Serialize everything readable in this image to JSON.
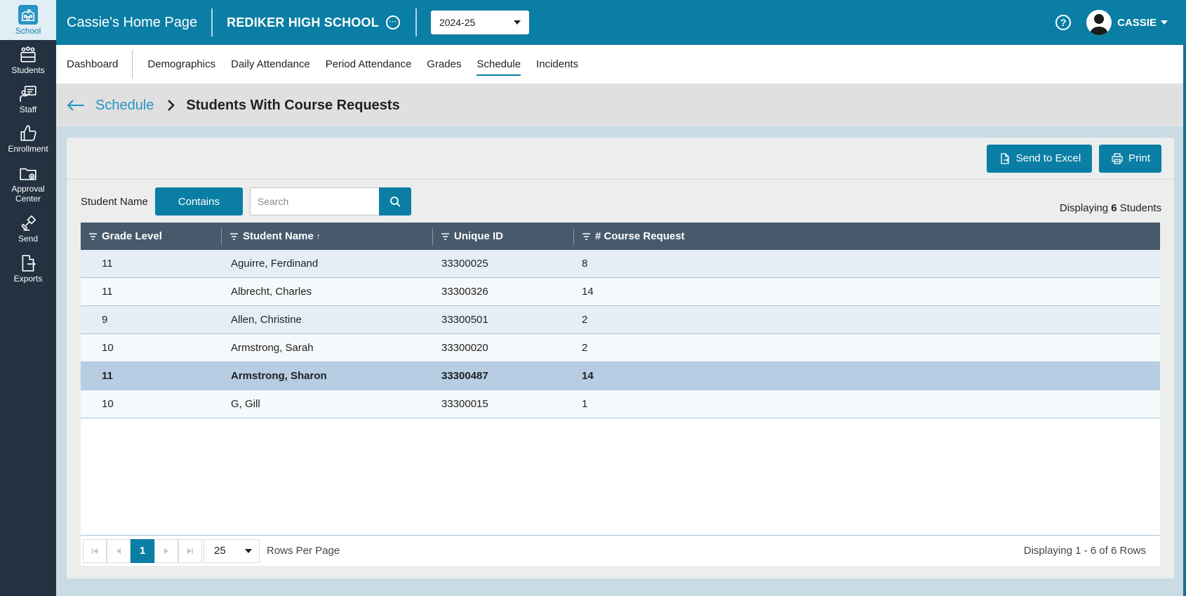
{
  "rail": {
    "items": [
      {
        "label": "School",
        "icon": "school-icon",
        "active": true
      },
      {
        "label": "Students",
        "icon": "students-icon"
      },
      {
        "label": "Staff",
        "icon": "staff-icon"
      },
      {
        "label": "Enrollment",
        "icon": "thumbs-up-icon"
      },
      {
        "label": "Approval Center",
        "icon": "folder-icon"
      },
      {
        "label": "Send",
        "icon": "satellite-icon"
      },
      {
        "label": "Exports",
        "icon": "export-file-icon"
      }
    ]
  },
  "header": {
    "home_title": "Cassie's Home Page",
    "school_name": "REDIKER HIGH SCHOOL",
    "school_year": "2024-25",
    "user_name": "CASSIE",
    "help_glyph": "?"
  },
  "nav": {
    "tabs": [
      {
        "label": "Dashboard"
      },
      {
        "label": "Demographics"
      },
      {
        "label": "Daily Attendance"
      },
      {
        "label": "Period Attendance"
      },
      {
        "label": "Grades"
      },
      {
        "label": "Schedule",
        "active": true
      },
      {
        "label": "Incidents"
      }
    ]
  },
  "breadcrumb": {
    "parent": "Schedule",
    "current": "Students With Course Requests"
  },
  "toolbar": {
    "excel_label": "Send to Excel",
    "print_label": "Print"
  },
  "filter": {
    "label": "Student Name",
    "mode": "Contains",
    "placeholder": "Search",
    "display_prefix": "Displaying",
    "display_count": "6",
    "display_suffix": "Students"
  },
  "table": {
    "columns": [
      "Grade Level",
      "Student Name",
      "Unique ID",
      "# Course Request"
    ],
    "sort_indicator": "↑",
    "rows": [
      {
        "grade": "11",
        "name": "Aguirre, Ferdinand",
        "id": "33300025",
        "requests": "8"
      },
      {
        "grade": "11",
        "name": "Albrecht, Charles",
        "id": "33300326",
        "requests": "14"
      },
      {
        "grade": "9",
        "name": "Allen, Christine",
        "id": "33300501",
        "requests": "2"
      },
      {
        "grade": "10",
        "name": "Armstrong, Sarah",
        "id": "33300020",
        "requests": "2"
      },
      {
        "grade": "11",
        "name": "Armstrong, Sharon",
        "id": "33300487",
        "requests": "14",
        "selected": true
      },
      {
        "grade": "10",
        "name": "G, Gill",
        "id": "33300015",
        "requests": "1"
      }
    ]
  },
  "pager": {
    "current_page": "1",
    "rows_per_page": "25",
    "rows_per_page_label": "Rows Per Page",
    "summary": "Displaying 1 - 6 of 6 Rows"
  },
  "colors": {
    "brand": "#0a7ea4",
    "rail": "#233140",
    "table_header": "#465a6c",
    "selected_row": "#b6cde4"
  }
}
